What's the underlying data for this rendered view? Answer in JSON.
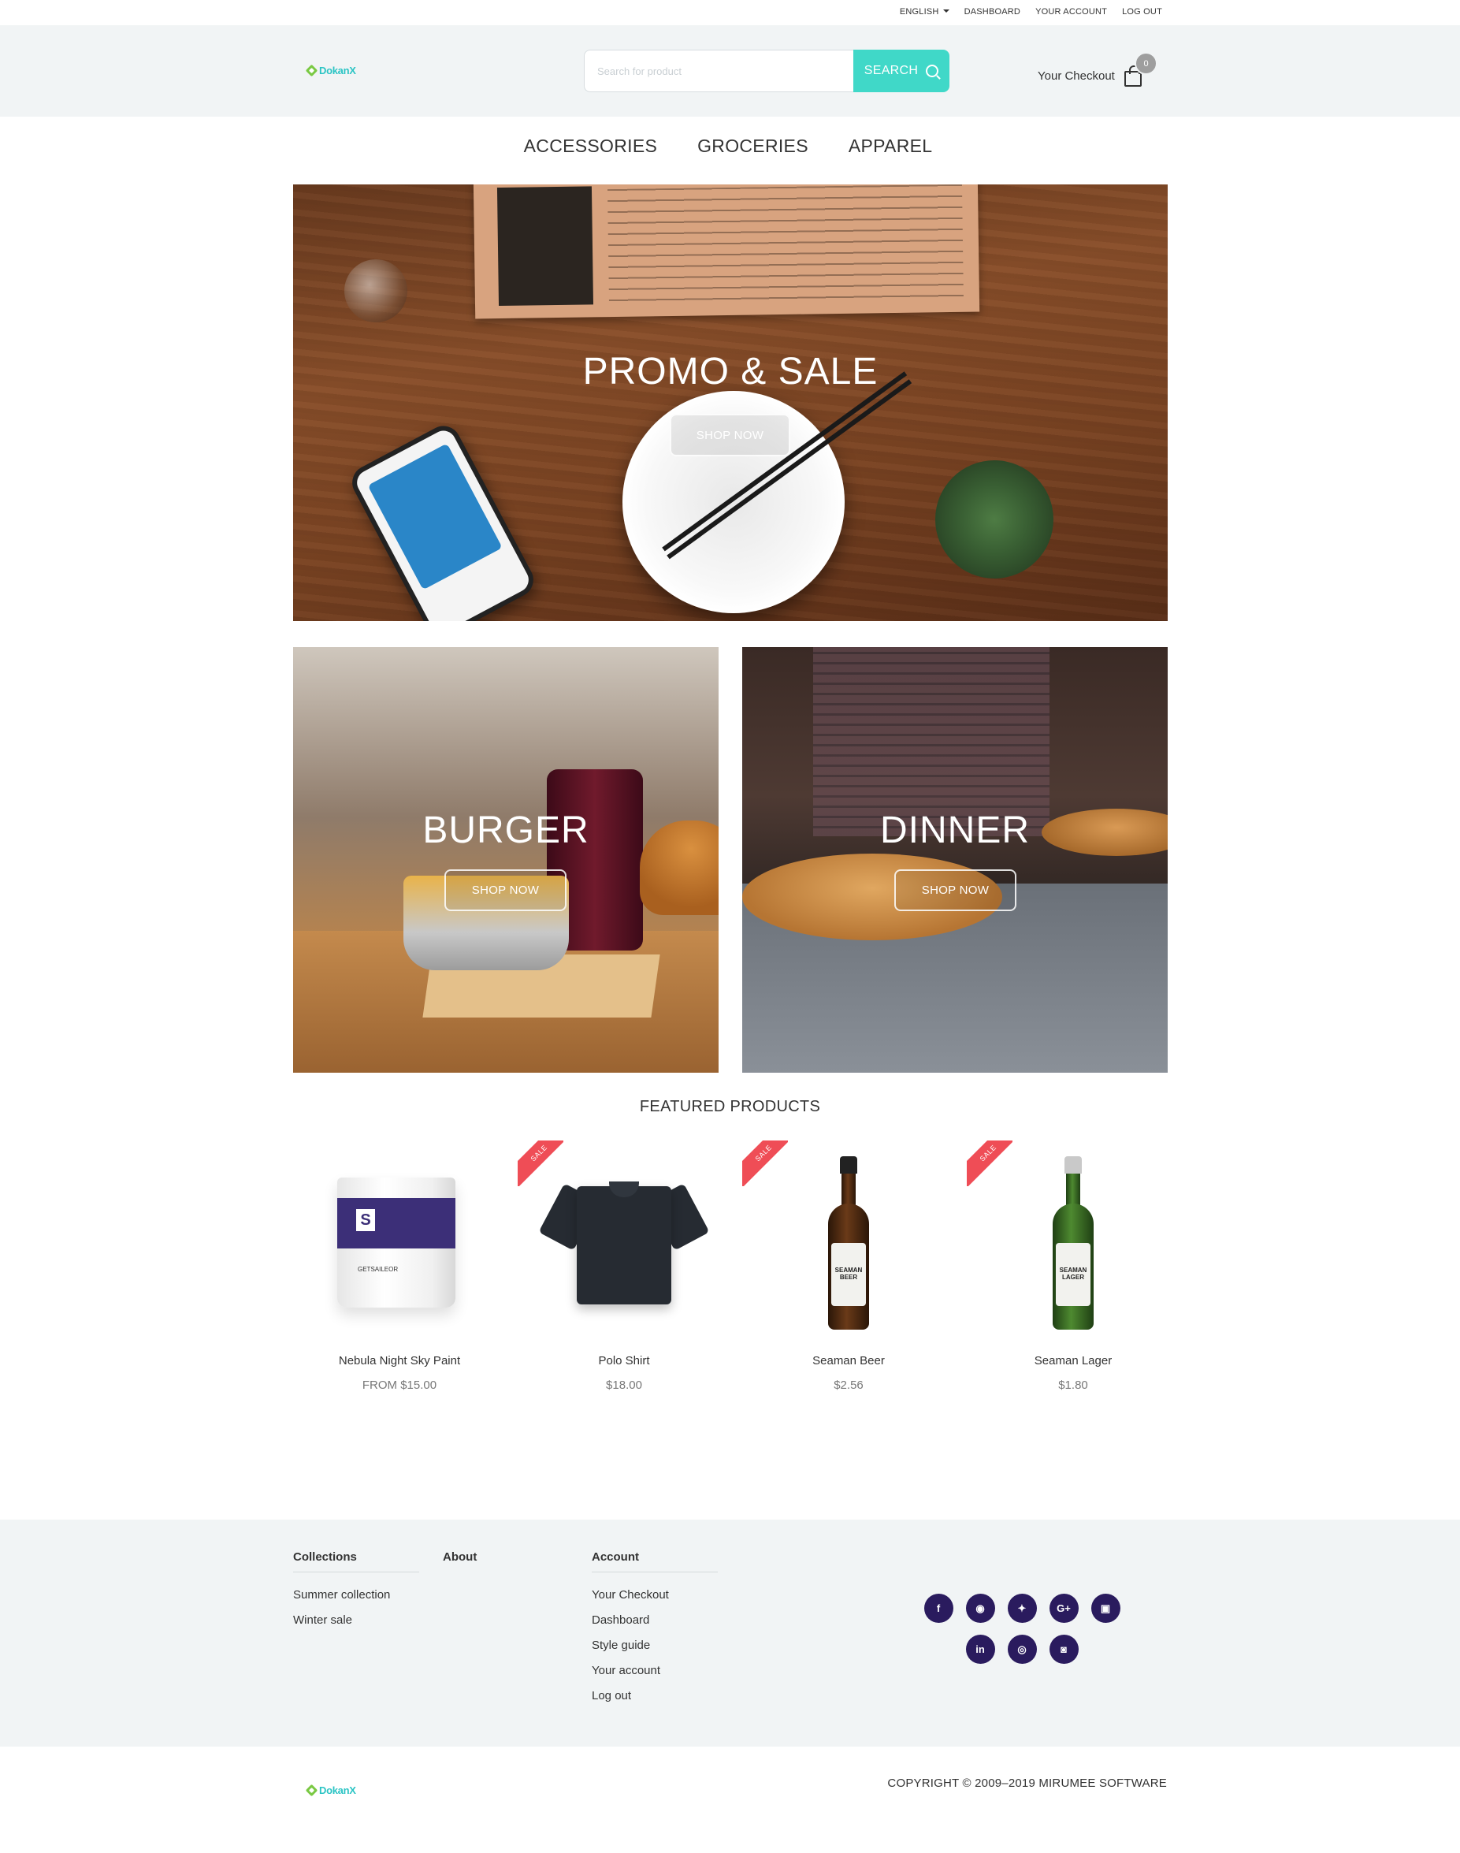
{
  "topbar": {
    "language": "ENGLISH",
    "dashboard": "DASHBOARD",
    "account": "YOUR ACCOUNT",
    "logout": "LOG OUT"
  },
  "header": {
    "logo_text": "DokanX",
    "search_placeholder": "Search for product",
    "search_button": "SEARCH",
    "checkout_label": "Your Checkout",
    "cart_count": "0"
  },
  "nav": [
    "ACCESSORIES",
    "GROCERIES",
    "APPAREL"
  ],
  "banners": {
    "hero": {
      "title": "PROMO & SALE",
      "button": "SHOP NOW"
    },
    "burger": {
      "title": "BURGER",
      "button": "SHOP NOW"
    },
    "dinner": {
      "title": "DINNER",
      "button": "SHOP NOW"
    }
  },
  "featured": {
    "title": "FEATURED PRODUCTS",
    "products": [
      {
        "name": "Nebula Night Sky Paint",
        "price": "FROM $15.00",
        "sale": false,
        "image_brand": "GETSAILEOR"
      },
      {
        "name": "Polo Shirt",
        "price": "$18.00",
        "sale": true
      },
      {
        "name": "Seaman Beer",
        "price": "$2.56",
        "sale": true,
        "image_label": "SEAMAN BEER"
      },
      {
        "name": "Seaman Lager",
        "price": "$1.80",
        "sale": true,
        "image_label": "SEAMAN LAGER"
      }
    ],
    "sale_label": "SALE"
  },
  "footer": {
    "collections": {
      "heading": "Collections",
      "items": [
        "Summer collection",
        "Winter sale"
      ]
    },
    "about": {
      "heading": "About"
    },
    "account": {
      "heading": "Account",
      "items": [
        "Your Checkout",
        "Dashboard",
        "Style guide",
        "Your account",
        "Log out"
      ]
    },
    "social": [
      "facebook-icon",
      "github-icon",
      "twitter-icon",
      "google-plus-icon",
      "picture-icon",
      "linkedin-icon",
      "dribbble-icon",
      "instagram-icon"
    ],
    "social_color": "#2a1b5e"
  },
  "bottom": {
    "logo_text": "DokanX",
    "copyright": "COPYRIGHT © 2009–2019 MIRUMEE SOFTWARE"
  },
  "colors": {
    "accent": "#40d8c8",
    "sale": "#ef4d56",
    "header_bg": "#f1f4f5"
  }
}
